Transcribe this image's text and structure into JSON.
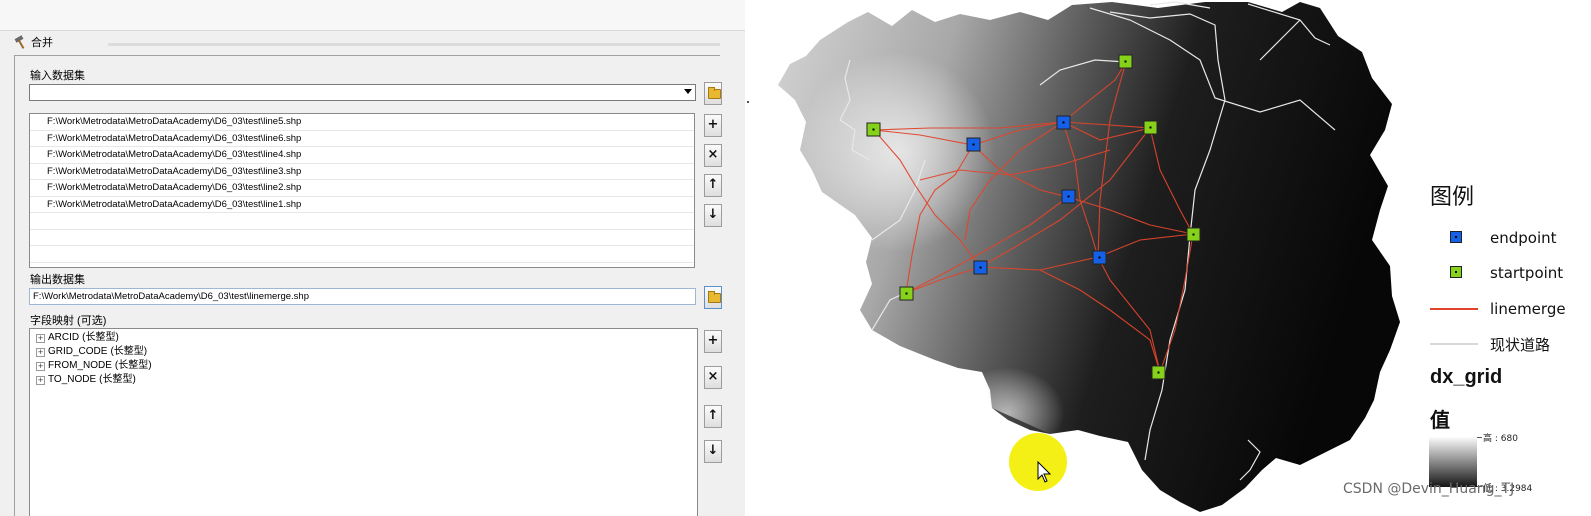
{
  "dialog": {
    "tool_title": "合并",
    "input_label": "输入数据集",
    "input_value": "",
    "input_files": [
      "F:\\Work\\Metrodata\\MetroDataAcademy\\D6_03\\test\\line5.shp",
      "F:\\Work\\Metrodata\\MetroDataAcademy\\D6_03\\test\\line6.shp",
      "F:\\Work\\Metrodata\\MetroDataAcademy\\D6_03\\test\\line4.shp",
      "F:\\Work\\Metrodata\\MetroDataAcademy\\D6_03\\test\\line3.shp",
      "F:\\Work\\Metrodata\\MetroDataAcademy\\D6_03\\test\\line2.shp",
      "F:\\Work\\Metrodata\\MetroDataAcademy\\D6_03\\test\\line1.shp"
    ],
    "output_label": "输出数据集",
    "output_value": "F:\\Work\\Metrodata\\MetroDataAcademy\\D6_03\\test\\linemerge.shp",
    "field_map_label": "字段映射 (可选)",
    "fields": [
      {
        "name": "ARCID",
        "type": "(长整型)"
      },
      {
        "name": "GRID_CODE",
        "type": "(长整型)"
      },
      {
        "name": "FROM_NODE",
        "type": "(长整型)"
      },
      {
        "name": "TO_NODE",
        "type": "(长整型)"
      }
    ],
    "buttons": {
      "add": "+",
      "remove": "×",
      "up": "↑",
      "down": "↓"
    }
  },
  "legend": {
    "title": "图例",
    "items": [
      {
        "label": "endpoint",
        "color": "#1560e8",
        "kind": "square"
      },
      {
        "label": "startpoint",
        "color": "#86d21a",
        "kind": "square"
      },
      {
        "label": "linemerge",
        "color": "#e0452c",
        "kind": "line"
      },
      {
        "label": "现状道路",
        "color": "#d8d8d8",
        "kind": "line"
      }
    ],
    "raster_name": "dx_grid",
    "value_label": "值",
    "high_label": "高 : 680",
    "low_label": "低 : 3.2984"
  },
  "map": {
    "endpoint_color": "#1560e8",
    "startpoint_color": "#86d21a",
    "line_color": "#e0452c"
  },
  "watermark": "CSDN @Devin_Huang_TJ"
}
